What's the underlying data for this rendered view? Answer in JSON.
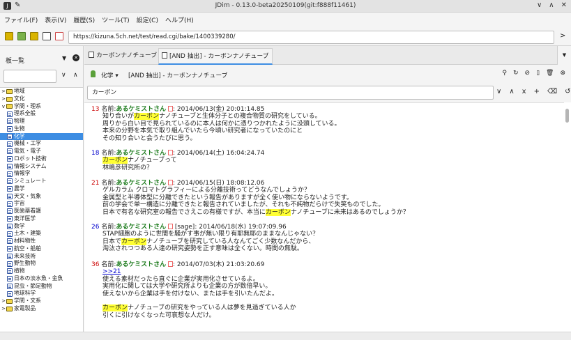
{
  "window": {
    "title": "JDim - 0.13.0-beta20250109(git:f888f11461)",
    "pin_icon": "pin-icon",
    "controls": [
      "∨",
      "∧",
      "✕"
    ]
  },
  "menu": [
    "ファイル(F)",
    "表示(V)",
    "履歴(S)",
    "ツール(T)",
    "設定(C)",
    "ヘルプ(H)"
  ],
  "url": "https://kizuna.5ch.net/test/read.cgi/bake/1400339280/",
  "left": {
    "title": "板一覧",
    "tree": [
      {
        "label": "地域",
        "type": "folder",
        "state": ">",
        "level": 0
      },
      {
        "label": "文化",
        "type": "folder",
        "state": ">",
        "level": 0
      },
      {
        "label": "学問・理系",
        "type": "folder",
        "state": "v",
        "level": 0
      },
      {
        "label": "理系全般",
        "type": "board",
        "level": 1
      },
      {
        "label": "物理",
        "type": "board",
        "level": 1
      },
      {
        "label": "生物",
        "type": "board",
        "level": 1
      },
      {
        "label": "化学",
        "type": "board",
        "level": 1,
        "selected": true
      },
      {
        "label": "機械・工学",
        "type": "board",
        "level": 1
      },
      {
        "label": "電気・電子",
        "type": "board",
        "level": 1
      },
      {
        "label": "ロボット技術",
        "type": "board",
        "level": 1
      },
      {
        "label": "情報システム",
        "type": "board",
        "level": 1
      },
      {
        "label": "情報学",
        "type": "board",
        "level": 1
      },
      {
        "label": "シミュレート",
        "type": "board",
        "level": 1
      },
      {
        "label": "農学",
        "type": "board",
        "level": 1
      },
      {
        "label": "天文・気象",
        "type": "board",
        "level": 1
      },
      {
        "label": "宇宙",
        "type": "board",
        "level": 1
      },
      {
        "label": "医歯薬看護",
        "type": "board",
        "level": 1
      },
      {
        "label": "東洋医学",
        "type": "board",
        "level": 1
      },
      {
        "label": "数学",
        "type": "board",
        "level": 1
      },
      {
        "label": "土木・建築",
        "type": "board",
        "level": 1
      },
      {
        "label": "材料物性",
        "type": "board",
        "level": 1
      },
      {
        "label": "航空・船舶",
        "type": "board",
        "level": 1
      },
      {
        "label": "未来技術",
        "type": "board",
        "level": 1
      },
      {
        "label": "野生動物",
        "type": "board",
        "level": 1
      },
      {
        "label": "植物",
        "type": "board",
        "level": 1
      },
      {
        "label": "日本の淡水魚・金魚",
        "type": "board",
        "level": 1
      },
      {
        "label": "昆虫・節足動物",
        "type": "board",
        "level": 1
      },
      {
        "label": "地球科学",
        "type": "board",
        "level": 1
      },
      {
        "label": "学問・文系",
        "type": "folder",
        "state": ">",
        "level": 0
      },
      {
        "label": "家電製品",
        "type": "folder",
        "state": ">",
        "level": 0
      }
    ]
  },
  "tabs": [
    {
      "label": "カーボンナノチューブ",
      "active": false
    },
    {
      "label": "[AND 抽出] - カーボンナノチューブ",
      "active": true
    }
  ],
  "board": {
    "name": "化学",
    "arrow": "▾",
    "thread": "[AND 抽出] - カーボンナノチューブ",
    "icons": [
      "search-icon",
      "reload-icon",
      "stop-icon",
      "bookmark-icon",
      "delete-icon",
      "close-icon"
    ]
  },
  "filter": {
    "value": "カーボン",
    "icons": [
      "∨",
      "∧",
      "x",
      "+",
      "⌫",
      "↺"
    ]
  },
  "posts": [
    {
      "num": "13",
      "name_prefix": "名前:",
      "name": "あるケミストさん",
      "info": ": 2014/06/13(金) 20:01:14.85",
      "lines": [
        [
          "知り合いが",
          "カーボン",
          "ナノチューブと生体分子との複合物質の研究をしている。"
        ],
        [
          "周りから白い目で見られているのに本人は何かに憑りつかれたように没頭している。"
        ],
        [
          "本来の分野を本気で取り組んでいたら今頃い研究者になっていたのにと"
        ],
        [
          "その知り合いと会うたびに思う。"
        ]
      ]
    },
    {
      "num": "18",
      "name_prefix": "名前:",
      "name": "あるケミストさん",
      "info": ": 2014/06/14(土) 16:04:24.74",
      "lines": [
        [
          "",
          "カーボン",
          "ナノチューブって"
        ],
        [
          "林嶋彦研究所の？"
        ]
      ]
    },
    {
      "num": "21",
      "name_prefix": "名前:",
      "name": "あるケミストさん",
      "info": ": 2014/06/15(日) 18:08:12.06",
      "lines": [
        [
          "ゲルカラム クロマトグラフィーによる分離技術ってどうなんでしょうか？"
        ],
        [
          "金属型と半導体型に分離できたという報告がありますが全く使い物にならないようです。"
        ],
        [
          "前の学会で単一構造に分離できたと報告されていましたが、それも不純物だらけで失笑ものでした。"
        ],
        [
          "日本で有名な研究室の報告でさえこの有様ですが、本当に",
          "カーボン",
          "ナノチューブに未来はあるのでしょうか？"
        ]
      ]
    },
    {
      "num": "26",
      "name_prefix": "名前:",
      "name": "あるケミストさん",
      "info": " [sage]: 2014/06/18(水) 19:07:09.96",
      "lines": [
        [
          "STAP細胞のように世間を騒がす事が無い限り有耶無耶のままなんじゃない？"
        ],
        [
          "日本で",
          "カーボン",
          "ナノチューブを研究している人なんてごく少数なんだから、"
        ],
        [
          "淘汰されつつある人達の研究姿勢を正す意味は全くない。時間の無駄。"
        ]
      ]
    },
    {
      "num": "36",
      "name_prefix": "名前:",
      "name": "あるケミストさん",
      "info": ": 2014/07/03(木) 21:03:20.69",
      "anchor": ">>21",
      "lines": [
        [
          "使える素材だったら直ぐに企業が実用化させているよ。"
        ],
        [
          "実用化に関しては大学や研究所よりも企業の方が数倍早い。"
        ],
        [
          "使えないから企業は手を付けない、または手を引いたんだよ。"
        ],
        [
          ""
        ],
        [
          "",
          "カーボン",
          "ナノチューブの研究をやっている人は夢を見過ぎている人か"
        ],
        [
          "引くに引けなくなった可哀想な人だけ。"
        ]
      ]
    }
  ]
}
